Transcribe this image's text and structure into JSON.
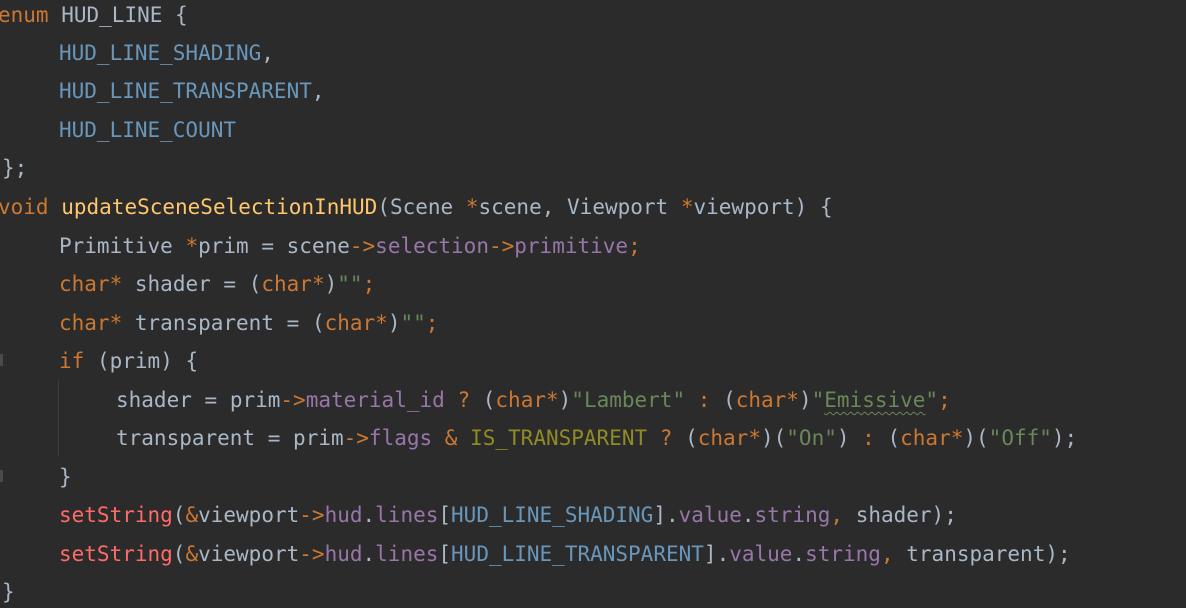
{
  "colors": {
    "background": "#2b2b2b",
    "keyword": "#cc7832",
    "identifier": "#a9b7c6",
    "enum_constant": "#6897bb",
    "function_declaration": "#ffc66d",
    "function_call": "#ff6b68",
    "member": "#9876aa",
    "string": "#6a8759"
  },
  "code": {
    "l1": {
      "kw": "enum",
      "name": "HUD_LINE",
      "brace": "{"
    },
    "l2": {
      "c": "HUD_LINE_SHADING",
      "p": ","
    },
    "l3": {
      "c": "HUD_LINE_TRANSPARENT",
      "p": ","
    },
    "l4": {
      "c": "HUD_LINE_COUNT"
    },
    "l5": {
      "p": "};"
    },
    "l6": {
      "kw": "void",
      "fn": "updateSceneSelectionInHUD",
      "p1": "(",
      "t1": "Scene",
      "star1": "*",
      "a1": "scene",
      "p2": ",",
      "t2": "Viewport",
      "star2": "*",
      "a2": "viewport",
      "p3": ") {"
    },
    "l7": {
      "t": "Primitive",
      "star": "*",
      "v": "prim",
      "eq": "=",
      "s": "scene",
      "ar1": "->",
      "m1": "selection",
      "ar2": "->",
      "m2": "primitive",
      "end": ";"
    },
    "l8": {
      "kw": "char",
      "star": "*",
      "v": "shader",
      "eq": "=",
      "po": "(",
      "ckw": "char",
      "cstar": "*",
      "pc": ")",
      "str": "\"\"",
      "end": ";"
    },
    "l9": {
      "kw": "char",
      "star": "*",
      "v": "transparent",
      "eq": "=",
      "po": "(",
      "ckw": "char",
      "cstar": "*",
      "pc": ")",
      "str": "\"\"",
      "end": ";"
    },
    "l10": {
      "kw": "if",
      "p1": "(",
      "v": "prim",
      "p2": ") {"
    },
    "l11": {
      "v": "shader",
      "eq": "=",
      "s": "prim",
      "ar": "->",
      "m": "material_id",
      "q": "?",
      "po1": "(",
      "ck1": "char",
      "cs1": "*",
      "pc1": ")",
      "str1": "\"Lambert\"",
      "colon": ":",
      "po2": "(",
      "ck2": "char",
      "cs2": "*",
      "pc2": ")",
      "str2a": "\"",
      "str2b": "Emissive",
      "str2c": "\"",
      "end": ";"
    },
    "l12": {
      "v": "transparent",
      "eq": "=",
      "s": "prim",
      "ar": "->",
      "m": "flags",
      "amp": "&",
      "macro": "IS_TRANSPARENT",
      "q": "?",
      "po1": "(",
      "ck1": "char",
      "cs1": "*",
      "pc1": ")(",
      "str1": "\"On\"",
      "pc1b": ")",
      "colon": ":",
      "po2": "(",
      "ck2": "char",
      "cs2": "*",
      "pc2": ")(",
      "str2": "\"Off\"",
      "end": ");"
    },
    "l13": {
      "p": "}"
    },
    "l14": {
      "fn": "setString",
      "p1": "(",
      "amp": "&",
      "v": "viewport",
      "ar": "->",
      "m1": "hud",
      "d1": ".",
      "m2": "lines",
      "b1": "[",
      "c": "HUD_LINE_SHADING",
      "b2": "]",
      "d2": ".",
      "m3": "value",
      "d3": ".",
      "m4": "string",
      "comma": ",",
      "arg": "shader",
      "end": ");"
    },
    "l15": {
      "fn": "setString",
      "p1": "(",
      "amp": "&",
      "v": "viewport",
      "ar": "->",
      "m1": "hud",
      "d1": ".",
      "m2": "lines",
      "b1": "[",
      "c": "HUD_LINE_TRANSPARENT",
      "b2": "]",
      "d2": ".",
      "m3": "value",
      "d3": ".",
      "m4": "string",
      "comma": ",",
      "arg": "transparent",
      "end": ");"
    },
    "l16": {
      "p": "}"
    }
  }
}
